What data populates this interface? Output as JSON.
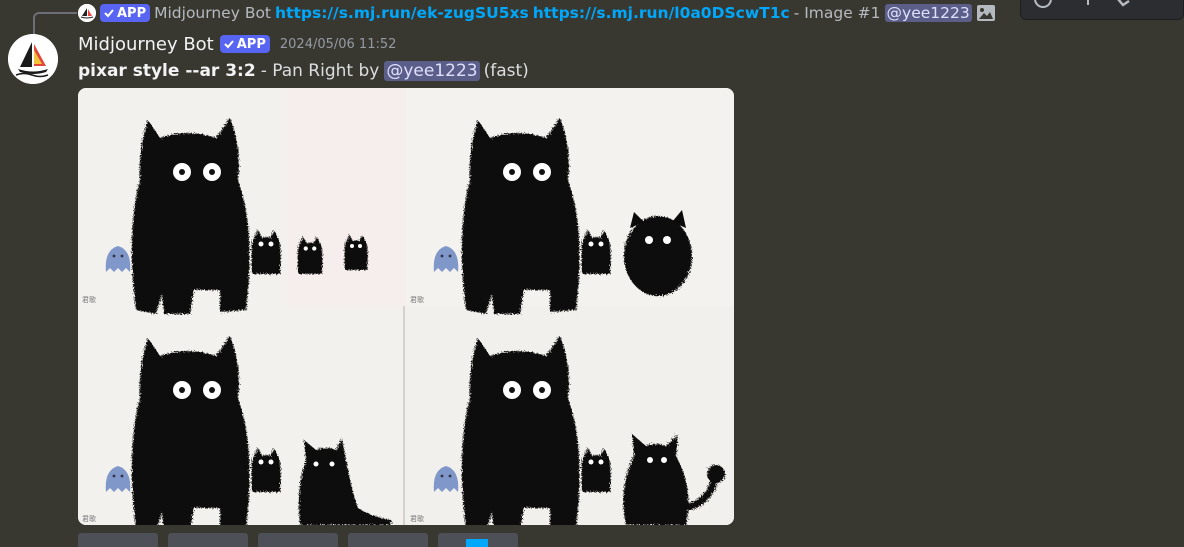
{
  "reply": {
    "author": "Midjourney Bot",
    "badge": "APP",
    "link1": "https://s.mj.run/ek-zugSU5xs",
    "link2": "https://s.mj.run/l0a0DScwT1c",
    "image_text": "- Image #1",
    "mention": "@yee1223",
    "icon": "image-icon"
  },
  "message": {
    "author": "Midjourney Bot",
    "badge": "APP",
    "timestamp": "2024/05/06 11:52",
    "prompt": "pixar style --ar 3:2",
    "action": "- Pan Right by",
    "mention": "@yee1223",
    "speed": "(fast)"
  },
  "colors": {
    "background": "#393830",
    "link": "#00a8fc",
    "badge": "#5865f2",
    "mention_bg": "#5c5e8a"
  },
  "toolbar": {
    "icons": [
      "reaction-icon",
      "more-icon",
      "edit-icon"
    ]
  },
  "image_grid": {
    "cells": 4,
    "watermark": "君歌"
  }
}
